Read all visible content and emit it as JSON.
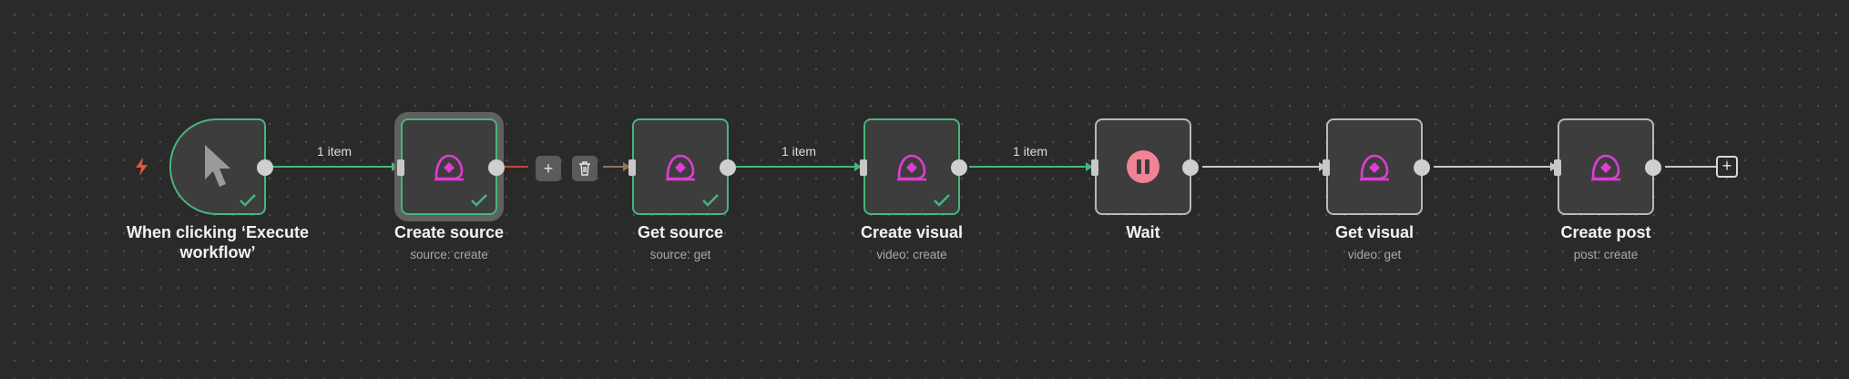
{
  "colors": {
    "canvas_bg": "#2a2a2a",
    "node_bg": "#3d3d3d",
    "success_border": "#47b57c",
    "connection_active": "#47b57c",
    "connection_idle": "#c8c8c8",
    "trigger_bolt": "#e5533d",
    "app_icon": "#e23bd6",
    "wait_icon": "#f08496"
  },
  "nodes": [
    {
      "label": "When clicking ‘Execute workflow’",
      "sublabel": "",
      "icon": "cursor-icon",
      "status": "success"
    },
    {
      "label": "Create source",
      "sublabel": "source: create",
      "icon": "app-logo-icon",
      "status": "success"
    },
    {
      "label": "Get source",
      "sublabel": "source: get",
      "icon": "app-logo-icon",
      "status": "success"
    },
    {
      "label": "Create visual",
      "sublabel": "video: create",
      "icon": "app-logo-icon",
      "status": "success"
    },
    {
      "label": "Wait",
      "sublabel": "",
      "icon": "pause-icon",
      "status": "idle"
    },
    {
      "label": "Get visual",
      "sublabel": "video: get",
      "icon": "app-logo-icon",
      "status": "idle"
    },
    {
      "label": "Create post",
      "sublabel": "post: create",
      "icon": "app-logo-icon",
      "status": "idle"
    }
  ],
  "connections": [
    {
      "item_count": "1 item"
    },
    {
      "item_count": ""
    },
    {
      "item_count": "1 item"
    },
    {
      "item_count": "1 item"
    },
    {
      "item_count": ""
    },
    {
      "item_count": ""
    }
  ],
  "edge_toolbar": {
    "add_label": "+",
    "delete_icon": "trash-icon"
  },
  "end_add_label": "+"
}
